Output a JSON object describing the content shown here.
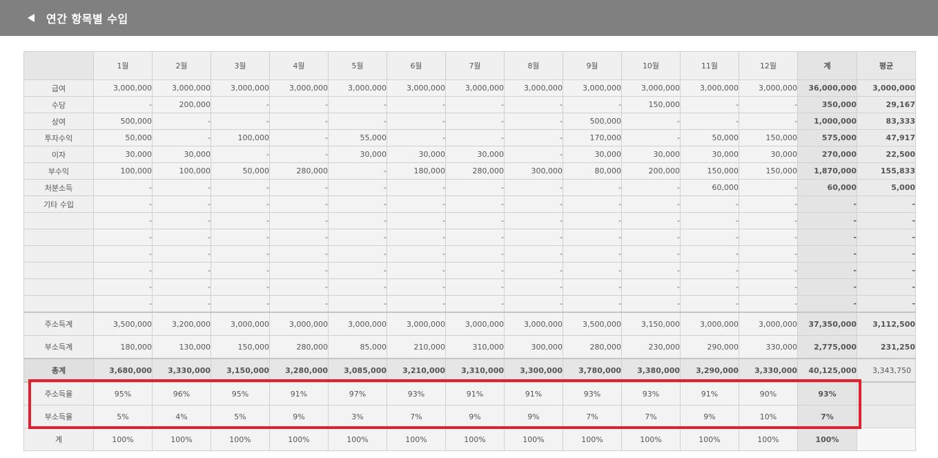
{
  "header": {
    "title": "연간 항목별 수입"
  },
  "columns": [
    "1월",
    "2월",
    "3월",
    "4월",
    "5월",
    "6월",
    "7월",
    "8월",
    "9월",
    "10월",
    "11월",
    "12월",
    "계",
    "평균"
  ],
  "rows": [
    {
      "label": "급여",
      "values": [
        "3,000,000",
        "3,000,000",
        "3,000,000",
        "3,000,000",
        "3,000,000",
        "3,000,000",
        "3,000,000",
        "3,000,000",
        "3,000,000",
        "3,000,000",
        "3,000,000",
        "3,000,000"
      ],
      "total": "36,000,000",
      "avg": "3,000,000"
    },
    {
      "label": "수당",
      "values": [
        "-",
        "200,000",
        "-",
        "-",
        "-",
        "-",
        "-",
        "-",
        "-",
        "150,000",
        "-",
        "-"
      ],
      "total": "350,000",
      "avg": "29,167"
    },
    {
      "label": "상여",
      "values": [
        "500,000",
        "-",
        "-",
        "-",
        "-",
        "-",
        "-",
        "-",
        "500,000",
        "-",
        "-",
        "-"
      ],
      "total": "1,000,000",
      "avg": "83,333"
    },
    {
      "label": "투자수익",
      "values": [
        "50,000",
        "-",
        "100,000",
        "-",
        "55,000",
        "-",
        "-",
        "-",
        "170,000",
        "-",
        "50,000",
        "150,000"
      ],
      "total": "575,000",
      "avg": "47,917"
    },
    {
      "label": "이자",
      "values": [
        "30,000",
        "30,000",
        "-",
        "-",
        "30,000",
        "30,000",
        "30,000",
        "-",
        "30,000",
        "30,000",
        "30,000",
        "30,000"
      ],
      "total": "270,000",
      "avg": "22,500"
    },
    {
      "label": "부수익",
      "values": [
        "100,000",
        "100,000",
        "50,000",
        "280,000",
        "-",
        "180,000",
        "280,000",
        "300,000",
        "80,000",
        "200,000",
        "150,000",
        "150,000"
      ],
      "total": "1,870,000",
      "avg": "155,833"
    },
    {
      "label": "처분소득",
      "values": [
        "-",
        "-",
        "-",
        "-",
        "-",
        "-",
        "-",
        "-",
        "-",
        "-",
        "60,000",
        "-"
      ],
      "total": "60,000",
      "avg": "5,000"
    },
    {
      "label": "기타 수입",
      "values": [
        "-",
        "-",
        "-",
        "-",
        "-",
        "-",
        "-",
        "-",
        "-",
        "-",
        "-",
        "-"
      ],
      "total": "-",
      "avg": "-"
    },
    {
      "label": "",
      "values": [
        "-",
        "-",
        "-",
        "-",
        "-",
        "-",
        "-",
        "-",
        "-",
        "-",
        "-",
        "-"
      ],
      "total": "-",
      "avg": "-"
    },
    {
      "label": "",
      "values": [
        "-",
        "-",
        "-",
        "-",
        "-",
        "-",
        "-",
        "-",
        "-",
        "-",
        "-",
        "-"
      ],
      "total": "-",
      "avg": "-"
    },
    {
      "label": "",
      "values": [
        "-",
        "-",
        "-",
        "-",
        "-",
        "-",
        "-",
        "-",
        "-",
        "-",
        "-",
        "-"
      ],
      "total": "-",
      "avg": "-"
    },
    {
      "label": "",
      "values": [
        "-",
        "-",
        "-",
        "-",
        "-",
        "-",
        "-",
        "-",
        "-",
        "-",
        "-",
        "-"
      ],
      "total": "-",
      "avg": "-"
    },
    {
      "label": "",
      "values": [
        "-",
        "-",
        "-",
        "-",
        "-",
        "-",
        "-",
        "-",
        "-",
        "-",
        "-",
        "-"
      ],
      "total": "-",
      "avg": "-"
    },
    {
      "label": "",
      "values": [
        "-",
        "-",
        "-",
        "-",
        "-",
        "-",
        "-",
        "-",
        "-",
        "-",
        "-",
        "-"
      ],
      "total": "-",
      "avg": "-"
    }
  ],
  "summary": [
    {
      "label": "주소득계",
      "values": [
        "3,500,000",
        "3,200,000",
        "3,000,000",
        "3,000,000",
        "3,000,000",
        "3,000,000",
        "3,000,000",
        "3,000,000",
        "3,500,000",
        "3,150,000",
        "3,000,000",
        "3,000,000"
      ],
      "total": "37,350,000",
      "avg": "3,112,500"
    },
    {
      "label": "부소득계",
      "values": [
        "180,000",
        "130,000",
        "150,000",
        "280,000",
        "85,000",
        "210,000",
        "310,000",
        "300,000",
        "280,000",
        "230,000",
        "290,000",
        "330,000"
      ],
      "total": "2,775,000",
      "avg": "231,250"
    }
  ],
  "grand_total": {
    "label": "총계",
    "values": [
      "3,680,000",
      "3,330,000",
      "3,150,000",
      "3,280,000",
      "3,085,000",
      "3,210,000",
      "3,310,000",
      "3,300,000",
      "3,780,000",
      "3,380,000",
      "3,290,000",
      "3,330,000"
    ],
    "total": "40,125,000",
    "avg": "3,343,750"
  },
  "ratios": [
    {
      "label": "주소득율",
      "values": [
        "95%",
        "96%",
        "95%",
        "91%",
        "97%",
        "93%",
        "91%",
        "91%",
        "93%",
        "93%",
        "91%",
        "90%"
      ],
      "total": "93%"
    },
    {
      "label": "부소득율",
      "values": [
        "5%",
        "4%",
        "5%",
        "9%",
        "3%",
        "7%",
        "9%",
        "9%",
        "7%",
        "7%",
        "9%",
        "10%"
      ],
      "total": "7%"
    },
    {
      "label": "계",
      "values": [
        "100%",
        "100%",
        "100%",
        "100%",
        "100%",
        "100%",
        "100%",
        "100%",
        "100%",
        "100%",
        "100%",
        "100%"
      ],
      "total": "100%"
    }
  ],
  "colors": {
    "highlight": "#e0202e",
    "header_bg": "#808080"
  }
}
